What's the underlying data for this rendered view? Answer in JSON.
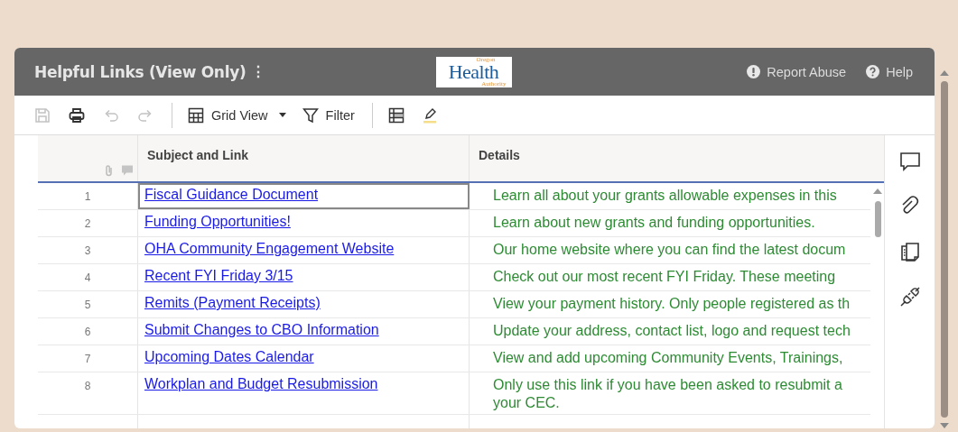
{
  "header": {
    "title": "Helpful Links (View Only)",
    "menu_glyph": "⋮",
    "logo": {
      "top": "Oregon",
      "main": "Health",
      "bottom": "Authority"
    },
    "actions": [
      {
        "kind": "report",
        "label": "Report Abuse"
      },
      {
        "kind": "help",
        "label": "Help"
      }
    ]
  },
  "toolbar": [
    {
      "kind": "save",
      "disabled": true
    },
    {
      "kind": "print",
      "disabled": false
    },
    {
      "kind": "undo",
      "disabled": true
    },
    {
      "kind": "redo",
      "disabled": true
    },
    {
      "kind": "divider"
    },
    {
      "kind": "gridview",
      "label": "Grid View",
      "disabled": false
    },
    {
      "kind": "filter",
      "label": "Filter",
      "disabled": false
    },
    {
      "kind": "divider"
    },
    {
      "kind": "table",
      "disabled": false
    },
    {
      "kind": "highlight",
      "disabled": false
    }
  ],
  "table": {
    "columns": [
      "Subject and Link",
      "Details"
    ],
    "rows": [
      {
        "number": "1",
        "subject": "Fiscal Guidance Document",
        "details": [
          "Learn all about your grants allowable expenses in this"
        ],
        "selected": true
      },
      {
        "number": "2",
        "subject": "Funding Opportunities!",
        "details": [
          "Learn about new grants and funding opportunities."
        ],
        "selected": false
      },
      {
        "number": "3",
        "subject": "OHA Community Engagement Website",
        "details": [
          "Our home website where you can find the latest docum"
        ],
        "selected": false
      },
      {
        "number": "4",
        "subject": "Recent FYI Friday 3/15",
        "details": [
          "Check out our most recent FYI Friday. These meeting"
        ],
        "selected": false
      },
      {
        "number": "5",
        "subject": "Remits (Payment Receipts)",
        "details": [
          "View your payment history. Only people registered as th"
        ],
        "selected": false
      },
      {
        "number": "6",
        "subject": "Submit Changes to CBO Information",
        "details": [
          "Update your address, contact list, logo and request tech"
        ],
        "selected": false
      },
      {
        "number": "7",
        "subject": "Upcoming Dates Calendar",
        "details": [
          "View and add upcoming Community Events, Trainings,"
        ],
        "selected": false
      },
      {
        "number": "8",
        "subject": "Workplan and Budget Resubmission",
        "details": [
          "Only use this link if you have been asked to resubmit a",
          "your CEC."
        ],
        "selected": false
      }
    ]
  },
  "side_panel": [
    {
      "kind": "comment"
    },
    {
      "kind": "attachment"
    },
    {
      "kind": "proofing"
    },
    {
      "kind": "connector"
    }
  ]
}
